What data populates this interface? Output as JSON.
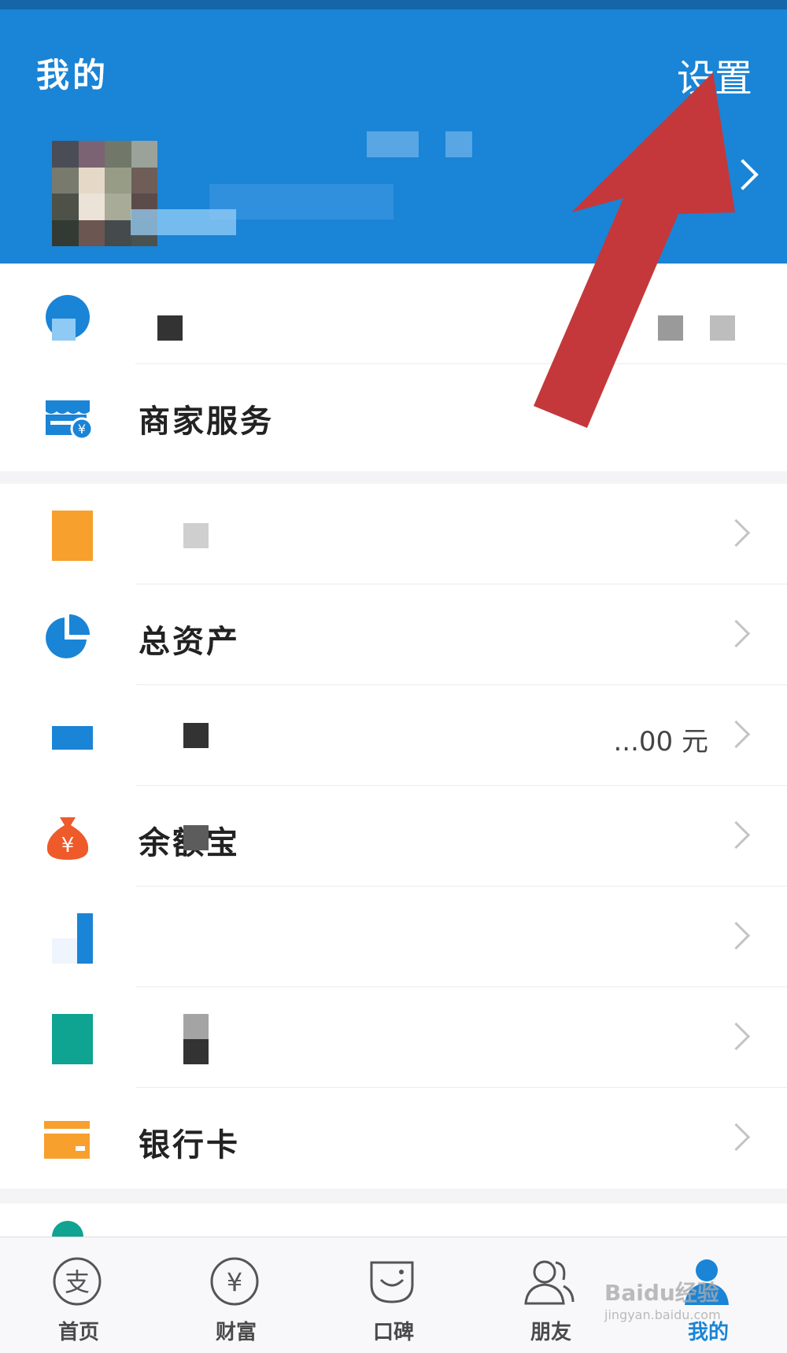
{
  "header": {
    "title": "我的",
    "settings_label": "设置",
    "accent_color": "#1a84d6"
  },
  "rows_top": [
    {
      "name": "blurred-item",
      "label": "",
      "icon": "blurred-icon"
    },
    {
      "name": "merchant-services",
      "label": "商家服务",
      "icon": "storefront-icon"
    }
  ],
  "rows_main": [
    {
      "name": "blurred-orange",
      "label": "",
      "icon": "orange-square-icon"
    },
    {
      "name": "total-assets",
      "label": "总资产",
      "icon": "pie-chart-icon"
    },
    {
      "name": "balance",
      "label": "",
      "value": "...00 元",
      "icon": "blue-bar-icon"
    },
    {
      "name": "yuebao",
      "label": "余额宝",
      "icon": "money-bag-icon"
    },
    {
      "name": "blurred-blue",
      "label": "",
      "icon": "blue-chart-icon"
    },
    {
      "name": "blurred-teal",
      "label": "",
      "icon": "teal-square-icon"
    },
    {
      "name": "bank-card",
      "label": "银行卡",
      "icon": "bank-card-icon"
    }
  ],
  "tabs": [
    {
      "label": "首页",
      "icon": "alipay-logo-icon"
    },
    {
      "label": "财富",
      "icon": "yen-circle-icon"
    },
    {
      "label": "口碑",
      "icon": "koubei-bag-icon"
    },
    {
      "label": "朋友",
      "icon": "friends-icon"
    },
    {
      "label": "我的",
      "icon": "user-icon",
      "active": true
    }
  ],
  "watermark": {
    "line1": "Baidu经验",
    "line2": "jingyan.baidu.com"
  }
}
